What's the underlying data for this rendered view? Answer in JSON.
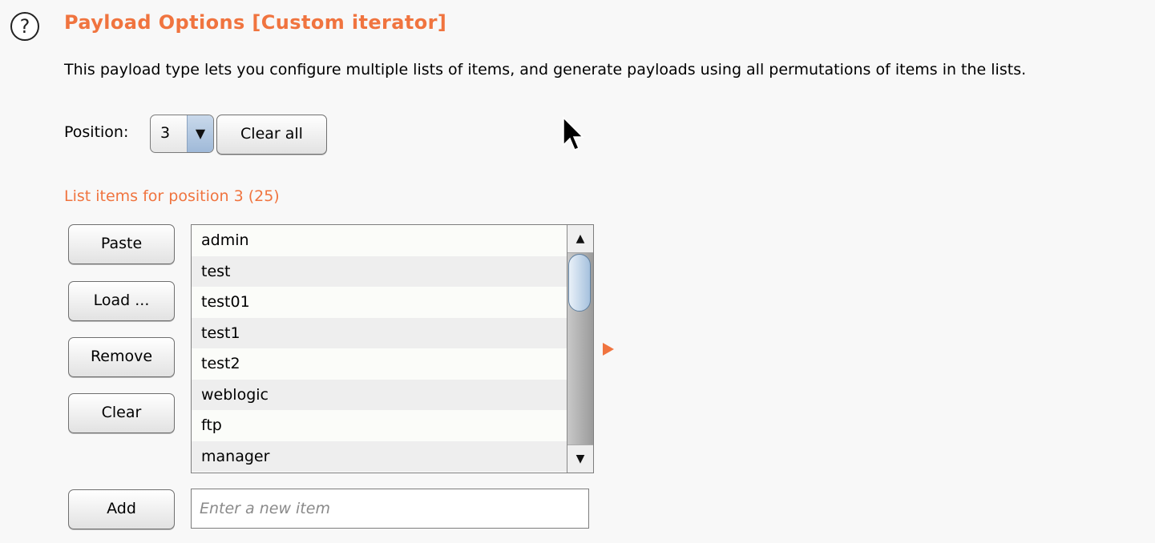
{
  "header": {
    "help_icon": "question-circle-icon",
    "help_glyph": "?",
    "title": "Payload Options [Custom iterator]",
    "description": "This payload type lets you configure multiple lists of items, and generate payloads using all permutations of items in the lists."
  },
  "position": {
    "label": "Position:",
    "selected": "3",
    "dropdown_icon": "triangle-down-icon",
    "dropdown_glyph": "▼",
    "clear_all_label": "Clear all"
  },
  "list": {
    "heading": "List items for position 3 (25)",
    "items": [
      "admin",
      "test",
      "test01",
      "test1",
      "test2",
      "weblogic",
      "ftp",
      "manager"
    ],
    "scroll_up_glyph": "▲",
    "scroll_down_glyph": "▼"
  },
  "buttons": {
    "paste": "Paste",
    "load": "Load ...",
    "remove": "Remove",
    "clear": "Clear",
    "add": "Add"
  },
  "add_item": {
    "value": "",
    "placeholder": "Enter a new item"
  },
  "colors": {
    "accent": "#f0743f",
    "background": "#f8f8f8",
    "scroll_thumb": "#a6c1dd"
  }
}
